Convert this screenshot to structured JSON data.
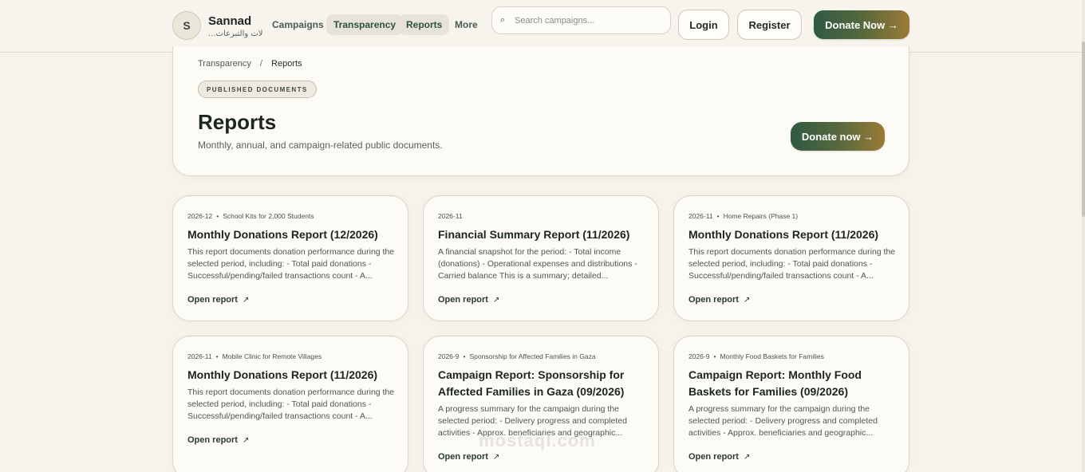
{
  "brand": {
    "initial": "S",
    "name": "Sannad",
    "subtitle": "...لات والتبرعات"
  },
  "nav": [
    {
      "label": "Campaigns"
    },
    {
      "label": "Transparency"
    },
    {
      "label": "Reports"
    },
    {
      "label": "More"
    }
  ],
  "search": {
    "placeholder": "Search campaigns..."
  },
  "header_actions": {
    "login": "Login",
    "register": "Register",
    "donate": "Donate Now →"
  },
  "breadcrumb": {
    "parent": "Transparency",
    "separator": "/",
    "current": "Reports"
  },
  "hero": {
    "badge": "PUBLISHED DOCUMENTS",
    "title": "Reports",
    "description": "Monthly, annual, and campaign-related public documents.",
    "donate_label": "Donate now →"
  },
  "cards": [
    {
      "date": "2026-12",
      "campaign": "School Kits for 2,000 Students",
      "title": "Monthly Donations Report (12/2026)",
      "description": "This report documents donation performance during the selected period, including: - Total paid donations - Successful/pending/failed transactions count - A...",
      "link": "Open report",
      "link_icon": "↗"
    },
    {
      "date": "2026-11",
      "campaign": "",
      "title": "Financial Summary Report (11/2026)",
      "description": "A financial snapshot for the period: - Total income (donations) - Operational expenses and distributions - Carried balance This is a summary; detailed...",
      "link": "Open report",
      "link_icon": "↗"
    },
    {
      "date": "2026-11",
      "campaign": "Home Repairs (Phase 1)",
      "title": "Monthly Donations Report (11/2026)",
      "description": "This report documents donation performance during the selected period, including: - Total paid donations - Successful/pending/failed transactions count - A...",
      "link": "Open report",
      "link_icon": "↗"
    },
    {
      "date": "2026-11",
      "campaign": "Mobile Clinic for Remote Villages",
      "title": "Monthly Donations Report (11/2026)",
      "description": "This report documents donation performance during the selected period, including: - Total paid donations - Successful/pending/failed transactions count - A...",
      "link": "Open report",
      "link_icon": "↗"
    },
    {
      "date": "2026-9",
      "campaign": "Sponsorship for Affected Families in Gaza",
      "title": "Campaign Report: Sponsorship for Affected Families in Gaza (09/2026)",
      "description": "A progress summary for the campaign during the selected period: - Delivery progress and completed activities - Approx. beneficiaries and geographic...",
      "link": "Open report",
      "link_icon": "↗"
    },
    {
      "date": "2026-9",
      "campaign": "Monthly Food Baskets for Families",
      "title": "Campaign Report: Monthly Food Baskets for Families (09/2026)",
      "description": "A progress summary for the campaign during the selected period: - Delivery progress and completed activities - Approx. beneficiaries and geographic...",
      "link": "Open report",
      "link_icon": "↗"
    }
  ],
  "watermark": "mostaql.com"
}
